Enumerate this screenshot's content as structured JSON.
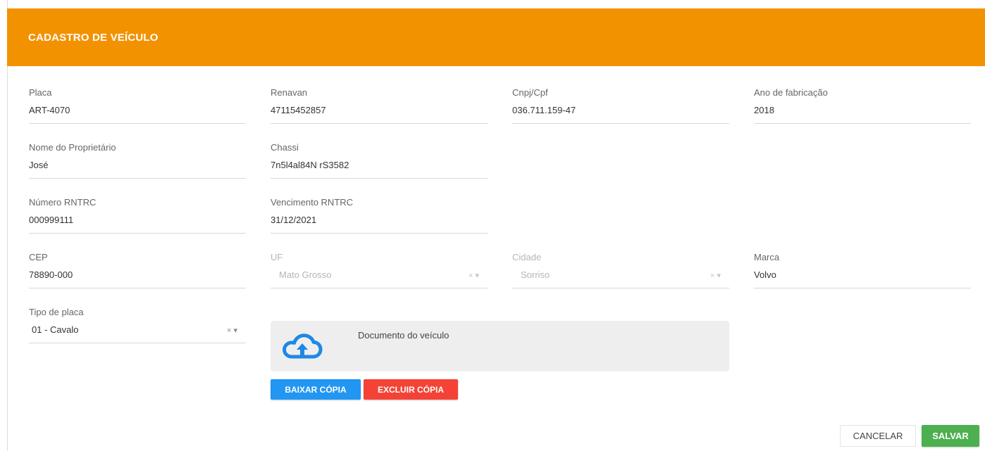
{
  "header": {
    "title": "CADASTRO DE VEÍCULO",
    "color": "#f39200"
  },
  "fields": {
    "placa": {
      "label": "Placa",
      "value": "ART-4070"
    },
    "renavan": {
      "label": "Renavan",
      "value": "47115452857"
    },
    "cnpj_cpf": {
      "label": "Cnpj/Cpf",
      "value": "036.711.159-47"
    },
    "ano_fabricacao": {
      "label": "Ano de fabricação",
      "value": "2018"
    },
    "nome_proprietario": {
      "label": "Nome do Proprietário",
      "value": "José"
    },
    "chassi": {
      "label": "Chassi",
      "value": "7n5l4al84N rS3582"
    },
    "numero_rntrc": {
      "label": "Número RNTRC",
      "value": "000999111"
    },
    "vencimento_rntrc": {
      "label": "Vencimento RNTRC",
      "value": "31/12/2021"
    },
    "cep": {
      "label": "CEP",
      "value": "78890-000"
    },
    "uf": {
      "label": "UF",
      "value": "Mato Grosso",
      "disabled": true
    },
    "cidade": {
      "label": "Cidade",
      "value": "Sorriso",
      "disabled": true
    },
    "marca": {
      "label": "Marca",
      "value": "Volvo"
    },
    "tipo_placa": {
      "label": "Tipo de placa",
      "value": "01 - Cavalo"
    }
  },
  "select_controls": {
    "clear": "×",
    "arrow": "▾"
  },
  "upload": {
    "label": "Documento do veículo",
    "icon": "cloud-upload-icon",
    "icon_color": "#1e88e5"
  },
  "buttons": {
    "download": {
      "label": "BAIXAR CÓPIA",
      "color": "#2196f3"
    },
    "delete": {
      "label": "EXCLUIR CÓPIA",
      "color": "#f44336"
    },
    "cancel": {
      "label": "CANCELAR"
    },
    "save": {
      "label": "SALVAR",
      "color": "#4caf50"
    }
  }
}
